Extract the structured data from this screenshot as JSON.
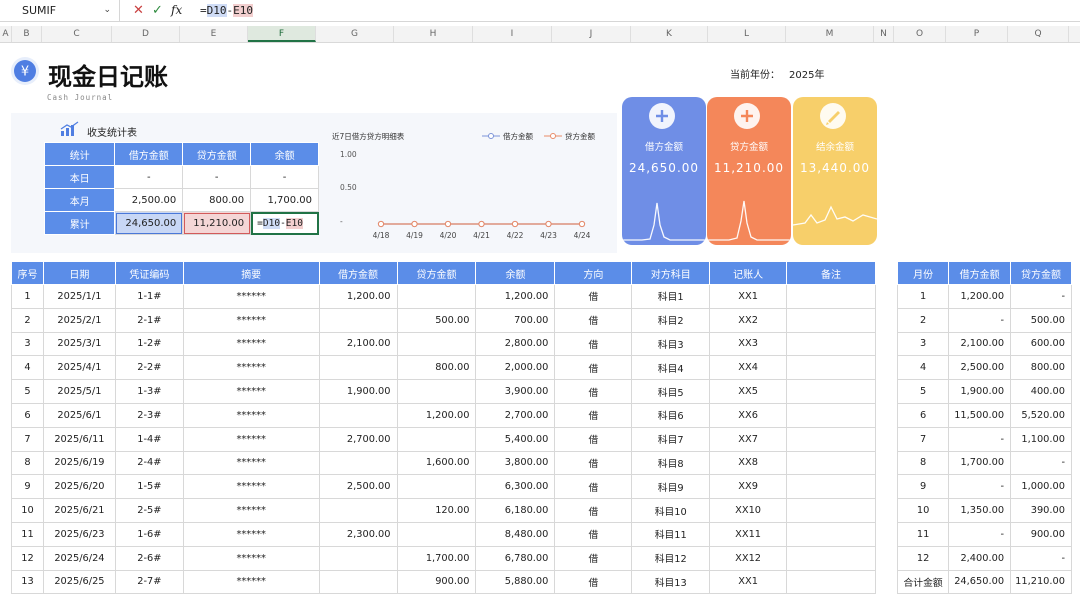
{
  "formula_bar": {
    "name_box": "SUMIF",
    "cancel_icon": "✕",
    "confirm_icon": "✓",
    "fx": "fx",
    "formula_prefix": "=",
    "ref1": "D10",
    "op": "-",
    "ref2": "E10"
  },
  "columns": [
    "A",
    "B",
    "C",
    "D",
    "E",
    "F",
    "G",
    "H",
    "I",
    "J",
    "K",
    "L",
    "M",
    "N",
    "O",
    "P",
    "Q"
  ],
  "header": {
    "title": "现金日记账",
    "subtitle": "Cash Journal",
    "year_label": "当前年份：",
    "year_value": "2025年"
  },
  "stats": {
    "title": "收支统计表",
    "headers": [
      "统计",
      "借方金额",
      "贷方金额",
      "余额"
    ],
    "rows": [
      {
        "label": "本日",
        "debit": "-",
        "credit": "-",
        "balance": "-"
      },
      {
        "label": "本月",
        "debit": "2,500.00",
        "credit": "800.00",
        "balance": "1,700.00"
      },
      {
        "label": "累计",
        "debit": "24,650.00",
        "credit": "11,210.00",
        "balance_prefix": "=",
        "balance_ref1": "D10",
        "balance_op": "-",
        "balance_ref2": "E10"
      }
    ]
  },
  "mini_chart": {
    "title": "近7日借方贷方明细表",
    "legend": [
      "借方金额",
      "贷方金额"
    ],
    "y_ticks": [
      "1.00",
      "0.50",
      "-"
    ],
    "colors": {
      "debit": "#7b93d8",
      "credit": "#e98b67"
    }
  },
  "chart_data": {
    "type": "line",
    "title": "近7日借方贷方明细表",
    "categories": [
      "4/18",
      "4/19",
      "4/20",
      "4/21",
      "4/22",
      "4/23",
      "4/24"
    ],
    "series": [
      {
        "name": "借方金额",
        "values": [
          0,
          0,
          0,
          0,
          0,
          0,
          0
        ]
      },
      {
        "name": "贷方金额",
        "values": [
          0,
          0,
          0,
          0,
          0,
          0,
          0
        ]
      }
    ],
    "ylim": [
      0,
      1
    ],
    "legend_position": "top-right"
  },
  "cards": [
    {
      "label": "借方金额",
      "value": "24,650.00",
      "color": "#6f8ee6",
      "icon": "plus-icon"
    },
    {
      "label": "贷方金额",
      "value": "11,210.00",
      "color": "#f4875a",
      "icon": "plus-icon"
    },
    {
      "label": "结余金额",
      "value": "13,440.00",
      "color": "#f7cf6a",
      "icon": "pen-icon"
    }
  ],
  "main_table": {
    "headers": [
      "序号",
      "日期",
      "凭证编码",
      "摘要",
      "借方金额",
      "贷方金额",
      "余额",
      "方向",
      "对方科目",
      "记账人",
      "备注"
    ],
    "rows": [
      [
        "1",
        "2025/1/1",
        "1-1#",
        "******",
        "1,200.00",
        "",
        "1,200.00",
        "借",
        "科目1",
        "XX1",
        ""
      ],
      [
        "2",
        "2025/2/1",
        "2-1#",
        "******",
        "",
        "500.00",
        "700.00",
        "借",
        "科目2",
        "XX2",
        ""
      ],
      [
        "3",
        "2025/3/1",
        "1-2#",
        "******",
        "2,100.00",
        "",
        "2,800.00",
        "借",
        "科目3",
        "XX3",
        ""
      ],
      [
        "4",
        "2025/4/1",
        "2-2#",
        "******",
        "",
        "800.00",
        "2,000.00",
        "借",
        "科目4",
        "XX4",
        ""
      ],
      [
        "5",
        "2025/5/1",
        "1-3#",
        "******",
        "1,900.00",
        "",
        "3,900.00",
        "借",
        "科目5",
        "XX5",
        ""
      ],
      [
        "6",
        "2025/6/1",
        "2-3#",
        "******",
        "",
        "1,200.00",
        "2,700.00",
        "借",
        "科目6",
        "XX6",
        ""
      ],
      [
        "7",
        "2025/6/11",
        "1-4#",
        "******",
        "2,700.00",
        "",
        "5,400.00",
        "借",
        "科目7",
        "XX7",
        ""
      ],
      [
        "8",
        "2025/6/19",
        "2-4#",
        "******",
        "",
        "1,600.00",
        "3,800.00",
        "借",
        "科目8",
        "XX8",
        ""
      ],
      [
        "9",
        "2025/6/20",
        "1-5#",
        "******",
        "2,500.00",
        "",
        "6,300.00",
        "借",
        "科目9",
        "XX9",
        ""
      ],
      [
        "10",
        "2025/6/21",
        "2-5#",
        "******",
        "",
        "120.00",
        "6,180.00",
        "借",
        "科目10",
        "XX10",
        ""
      ],
      [
        "11",
        "2025/6/23",
        "1-6#",
        "******",
        "2,300.00",
        "",
        "8,480.00",
        "借",
        "科目11",
        "XX11",
        ""
      ],
      [
        "12",
        "2025/6/24",
        "2-6#",
        "******",
        "",
        "1,700.00",
        "6,780.00",
        "借",
        "科目12",
        "XX12",
        ""
      ],
      [
        "13",
        "2025/6/25",
        "2-7#",
        "******",
        "",
        "900.00",
        "5,880.00",
        "借",
        "科目13",
        "XX1",
        ""
      ]
    ]
  },
  "side_table": {
    "headers": [
      "月份",
      "借方金额",
      "贷方金额"
    ],
    "rows": [
      [
        "1",
        "1,200.00",
        "-"
      ],
      [
        "2",
        "-",
        "500.00"
      ],
      [
        "3",
        "2,100.00",
        "600.00"
      ],
      [
        "4",
        "2,500.00",
        "800.00"
      ],
      [
        "5",
        "1,900.00",
        "400.00"
      ],
      [
        "6",
        "11,500.00",
        "5,520.00"
      ],
      [
        "7",
        "-",
        "1,100.00"
      ],
      [
        "8",
        "1,700.00",
        "-"
      ],
      [
        "9",
        "-",
        "1,000.00"
      ],
      [
        "10",
        "1,350.00",
        "390.00"
      ],
      [
        "11",
        "-",
        "900.00"
      ],
      [
        "12",
        "2,400.00",
        "-"
      ],
      [
        "合计金额",
        "24,650.00",
        "11,210.00"
      ]
    ]
  }
}
